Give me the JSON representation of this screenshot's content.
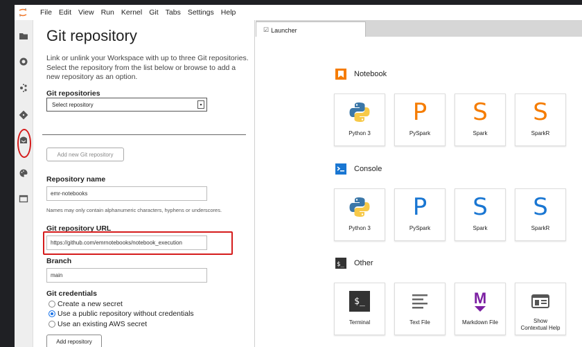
{
  "menu": [
    "File",
    "Edit",
    "View",
    "Run",
    "Kernel",
    "Git",
    "Tabs",
    "Settings",
    "Help"
  ],
  "panel": {
    "title": "Git repository",
    "description": "Link or unlink your Workspace with up to three Git repositories. Select the repository from the list below or browse to add a new repository as an option.",
    "git_repositories_label": "Git repositories",
    "select_placeholder": "Select repository",
    "add_new_button": "Add new Git repository",
    "repo_name_label": "Repository name",
    "repo_name_value": "emr-notebooks",
    "repo_name_hint": "Names may only contain alphanumeric characters, hyphens or underscores.",
    "url_label": "Git repository URL",
    "url_value": "https://github.com/emrnotebooks/notebook_execution",
    "branch_label": "Branch",
    "branch_value": "main",
    "credentials_label": "Git credentials",
    "credential_options": [
      {
        "label": "Create a new secret",
        "selected": false
      },
      {
        "label": "Use a public repository without credentials",
        "selected": true
      },
      {
        "label": "Use an existing AWS secret",
        "selected": false
      }
    ],
    "add_repository_button": "Add repository"
  },
  "tab": {
    "label": "Launcher"
  },
  "launcher": {
    "sections": [
      {
        "title": "Notebook",
        "icon": "notebook-icon",
        "cards": [
          {
            "label": "Python 3",
            "icon": "python-logo"
          },
          {
            "label": "PySpark",
            "icon": "pyspark-letter"
          },
          {
            "label": "Spark",
            "icon": "spark-letter"
          },
          {
            "label": "SparkR",
            "icon": "sparkr-letter"
          }
        ]
      },
      {
        "title": "Console",
        "icon": "console-icon",
        "cards": [
          {
            "label": "Python 3",
            "icon": "python-logo"
          },
          {
            "label": "PySpark",
            "icon": "pyspark-letter"
          },
          {
            "label": "Spark",
            "icon": "spark-letter"
          },
          {
            "label": "SparkR",
            "icon": "sparkr-letter"
          }
        ]
      },
      {
        "title": "Other",
        "icon": "terminal-icon",
        "cards": [
          {
            "label": "Terminal",
            "icon": "terminal-icon"
          },
          {
            "label": "Text File",
            "icon": "text-file-icon"
          },
          {
            "label": "Markdown File",
            "icon": "markdown-icon"
          },
          {
            "label": "Show Contextual Help",
            "icon": "contextual-help-icon"
          }
        ]
      }
    ],
    "letters": {
      "pyspark": "P",
      "spark": "S",
      "sparkr": "S",
      "markdown": "M",
      "terminal": "$_"
    }
  },
  "colors": {
    "notebook_orange": "#f57c00",
    "console_blue": "#1976d2",
    "highlight_red": "#d51b1b",
    "markdown_purple": "#7b1fa2"
  }
}
